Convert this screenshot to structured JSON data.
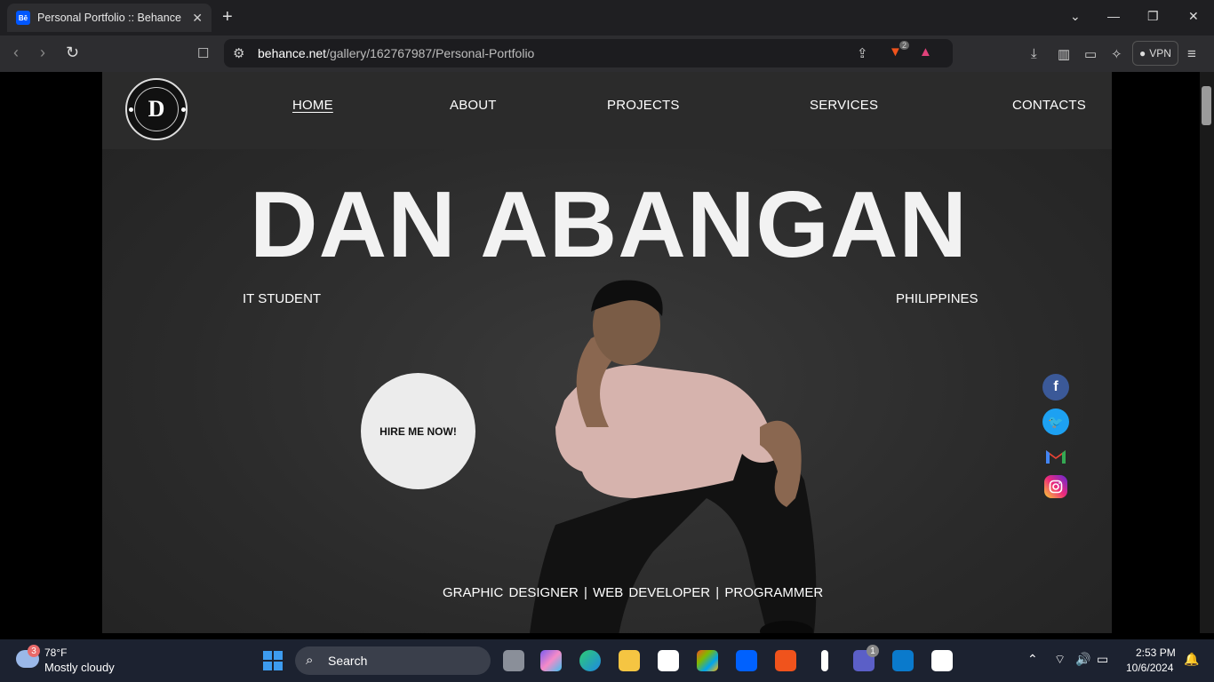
{
  "browser": {
    "tab_title": "Personal Portfolio :: Behance",
    "favicon_text": "Bē",
    "url_host": "behance.net",
    "url_path": "/gallery/162767987/Personal-Portfolio",
    "vpn_label": "VPN",
    "brave_badge": "2"
  },
  "site": {
    "logo_letter": "D",
    "nav": [
      "HOME",
      "ABOUT",
      "PROJECTS",
      "SERVICES",
      "CONTACTS"
    ],
    "hero_title": "DAN ABANGAN",
    "subtitle_left": "IT STUDENT",
    "subtitle_right": "PHILIPPINES",
    "hire_button": "HIRE ME NOW!",
    "roles": "GRAPHIC DESIGNER |   WEB DEVELOPER |   PROGRAMMER",
    "social": [
      "facebook",
      "twitter",
      "gmail",
      "instagram"
    ],
    "social_colors": {
      "facebook": "#3b5998",
      "twitter": "#1da1f2",
      "gmail": "#ffffff",
      "instagram": "#e1306c"
    }
  },
  "taskbar": {
    "weather_badge": "3",
    "weather_temp": "78°F",
    "weather_desc": "Mostly cloudy",
    "search_label": "Search",
    "teams_badge": "1",
    "time": "2:53 PM",
    "date": "10/6/2024"
  }
}
